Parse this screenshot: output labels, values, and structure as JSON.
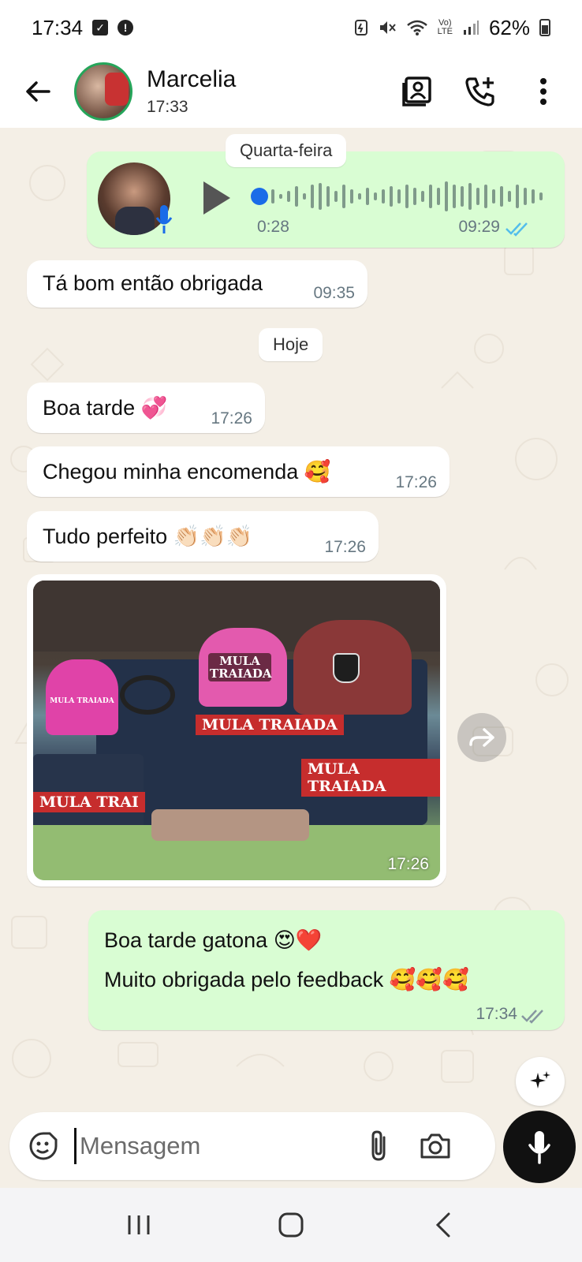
{
  "status_bar": {
    "time": "17:34",
    "battery": "62%",
    "network_label": "LTE",
    "volte_label": "Vo)"
  },
  "header": {
    "contact_name": "Marcelia",
    "last_seen": "17:33"
  },
  "chat": {
    "date_quarta": "Quarta-feira",
    "date_hoje": "Hoje",
    "voice_note": {
      "duration": "0:28",
      "time": "09:29"
    },
    "messages": [
      {
        "text": "Tá bom então obrigada",
        "time": "09:35"
      },
      {
        "text": "Boa tarde",
        "emoji": "💞",
        "time": "17:26"
      },
      {
        "text": "Chegou minha encomenda",
        "emoji": "🥰",
        "time": "17:26"
      },
      {
        "text": "Tudo perfeito",
        "emoji": "👏🏻👏🏻👏🏻",
        "time": "17:26"
      }
    ],
    "photo": {
      "time": "17:26",
      "cap_left_label": "MULA TRAIADA",
      "cap_center_label": "MULA TRAIADA",
      "banner_1": "MULA TRAIADA",
      "banner_2": "MULA TRAIADA",
      "banner_3": "MULA TRAI"
    },
    "reply": {
      "line1": "Boa tarde gatona",
      "line1_emoji": "😍❤️",
      "line2": "Muito obrigada pelo feedback",
      "line2_emoji": "🥰🥰🥰",
      "time": "17:34"
    }
  },
  "composer": {
    "placeholder": "Mensagem"
  },
  "colors": {
    "incoming": "#ffffff",
    "outgoing": "#d9fdd3",
    "wallpaper": "#f4efe6",
    "read_ticks": "#53bdeb",
    "accent_green": "#25a55a"
  }
}
